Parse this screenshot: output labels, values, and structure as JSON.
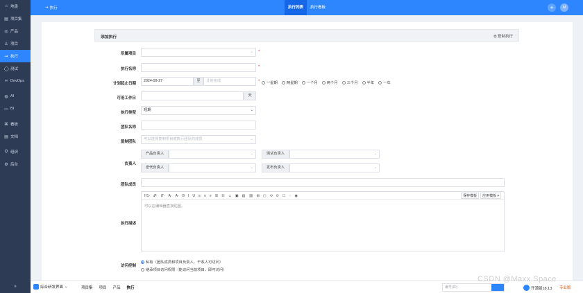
{
  "sidebar": {
    "items": [
      {
        "icon": "⌂",
        "label": "地盘"
      },
      {
        "icon": "▤",
        "label": "项目集"
      },
      {
        "icon": "◎",
        "label": "产品"
      },
      {
        "icon": "♙",
        "label": "项目"
      },
      {
        "icon": "⇝",
        "label": "执行",
        "active": true
      },
      {
        "icon": "◯",
        "label": "测试"
      },
      {
        "icon": "∞",
        "label": "DevOps"
      },
      {
        "icon": "◍",
        "label": "AI"
      },
      {
        "icon": "▭",
        "label": "BI"
      },
      {
        "icon": "⌘",
        "label": "看板"
      },
      {
        "icon": "▤",
        "label": "文档"
      },
      {
        "icon": "⛭",
        "label": "组织"
      },
      {
        "icon": "⚙",
        "label": "后台"
      }
    ],
    "collapse_icon": "»"
  },
  "header": {
    "crumb": "执行",
    "tabs": [
      "执行列表",
      "执行看板"
    ],
    "plus": "+",
    "avatar": "M"
  },
  "form": {
    "title": "添加执行",
    "copy_label": "复制执行",
    "fields": {
      "project_label": "所属项目",
      "name_label": "执行名称",
      "dates_label": "计划起止日期",
      "start_date": "2024-09-27",
      "to_label": "至",
      "end_placeholder": "计划完成",
      "workdays_label": "可用工作日",
      "days_unit": "天",
      "type_label": "执行类型",
      "type_value": "短期",
      "team_name_label": "团队名称",
      "copy_team_label": "复制团队",
      "copy_team_placeholder": "可以选择复制项目或执行团队的成员",
      "owners_label": "负责人",
      "po_label": "产品负责人",
      "qd_label": "测试负责人",
      "pm_label": "迭代负责人",
      "rd_label": "发布负责人",
      "members_label": "团队成员",
      "desc_label": "执行描述",
      "desc_placeholder": "可以在编辑器直接贴图。",
      "access_label": "访问控制",
      "access_private": "私有（团队成员和项目负责人、干系人可访问）",
      "access_inherit": "继承项目访问权限（能访问当前项目，即可访问）"
    },
    "durations": [
      "一星期",
      "两星期",
      "一个月",
      "两个月",
      "三个月",
      "半年",
      "一年"
    ],
    "editor_tools": [
      "H1·",
      "𝒯·",
      "tT·",
      "A·",
      "A·",
      "B",
      "I",
      "U",
      "≡",
      "≡",
      "≡",
      "☰",
      "☷",
      "☺",
      "▣",
      "▥",
      "⛓",
      "⊞",
      "▢",
      "⟲",
      "⟳",
      "☐",
      "◌",
      "◉"
    ],
    "editor_right": [
      "保存模板",
      "应用模板 ▾"
    ]
  },
  "bottom": {
    "program": "综合研发界面",
    "links": [
      "项目集",
      "项目",
      "产品",
      "执行"
    ],
    "search_placeholder": "编号(ID)",
    "version": "开源版18.13",
    "upgrade": "专业版"
  },
  "watermark": "CSDN @Maxx Space"
}
